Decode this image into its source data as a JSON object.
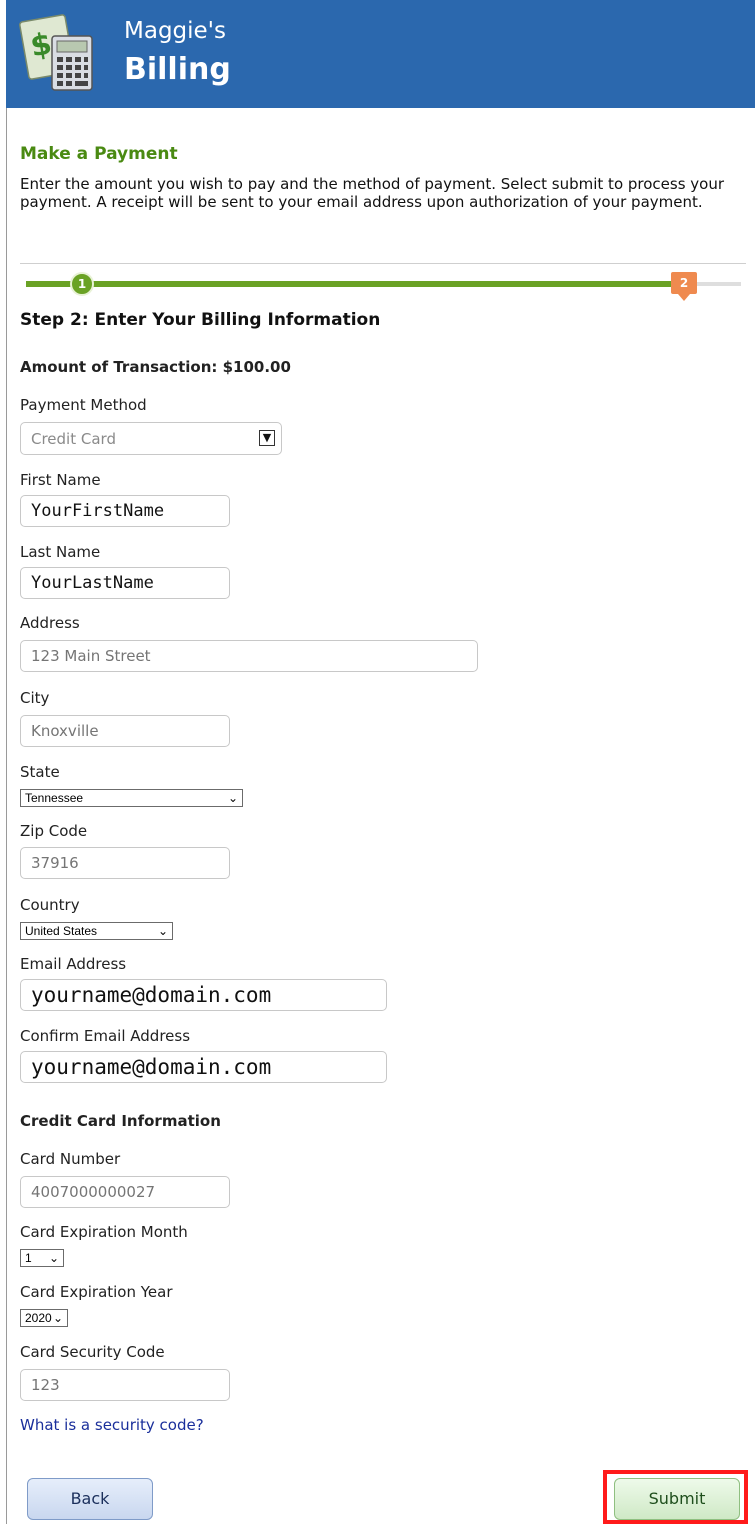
{
  "header": {
    "brand_line1": "Maggie's",
    "brand_line2": "Billing",
    "bg_color": "#2b68ae"
  },
  "page": {
    "section_title": "Make a Payment",
    "intro": "Enter the amount you wish to pay and the method of payment. Select submit to process your payment. A receipt will be sent to your email address upon authorization of your payment."
  },
  "progress": {
    "step1_label": "1",
    "step2_label": "2",
    "current_step": 2,
    "total_steps": 2
  },
  "step": {
    "heading": "Step 2: Enter Your Billing Information"
  },
  "amount": "Amount of Transaction: $100.00",
  "form": {
    "payment_method": {
      "label": "Payment Method",
      "value": "Credit Card"
    },
    "first_name": {
      "label": "First Name",
      "value": "YourFirstName"
    },
    "last_name": {
      "label": "Last Name",
      "value": "YourLastName"
    },
    "address": {
      "label": "Address",
      "placeholder": "123 Main Street"
    },
    "city": {
      "label": "City",
      "placeholder": "Knoxville"
    },
    "state": {
      "label": "State",
      "value": "Tennessee"
    },
    "zip": {
      "label": "Zip Code",
      "placeholder": "37916"
    },
    "country": {
      "label": "Country",
      "value": "United States"
    },
    "email": {
      "label": "Email Address",
      "value": "yourname@domain.com"
    },
    "confirm_email": {
      "label": "Confirm Email Address",
      "value": "yourname@domain.com"
    }
  },
  "credit_card": {
    "heading": "Credit Card Information",
    "number": {
      "label": "Card Number",
      "placeholder": "4007000000027"
    },
    "exp_month": {
      "label": "Card Expiration Month",
      "value": "1"
    },
    "exp_year": {
      "label": "Card Expiration Year",
      "value": "2020"
    },
    "security_code": {
      "label": "Card Security Code",
      "placeholder": "123"
    },
    "help_link": "What is a security code?"
  },
  "buttons": {
    "back": "Back",
    "submit": "Submit"
  },
  "colors": {
    "accent_green": "#6aa225",
    "step_orange": "#ef8a4f",
    "highlight_red": "#ff1a1a"
  }
}
